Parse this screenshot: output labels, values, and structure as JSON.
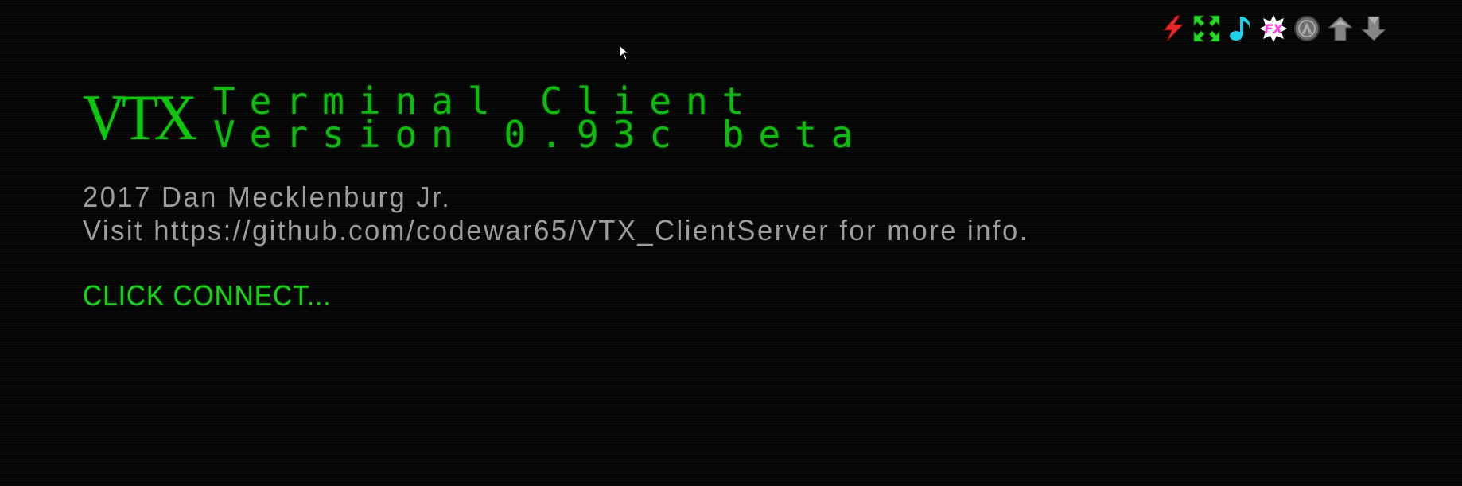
{
  "toolbar": {
    "items": [
      {
        "icon": "lightning-icon",
        "color": "#e8282c"
      },
      {
        "icon": "fullscreen-arrows-icon",
        "color": "#2ed82e"
      },
      {
        "icon": "music-note-icon",
        "color": "#1fd0e6"
      },
      {
        "icon": "fx-icon",
        "label": "FX",
        "color": "#ff3de0"
      },
      {
        "icon": "circle-a-icon",
        "color": "#8a8a8a"
      },
      {
        "icon": "upload-arrow-icon",
        "color": "#8a8a8a"
      },
      {
        "icon": "download-arrow-icon",
        "color": "#8a8a8a"
      }
    ]
  },
  "header": {
    "logo": "VTX",
    "title_line1": "Terminal Client",
    "title_line2": "Version 0.93c beta"
  },
  "info": {
    "line1": "2017 Dan Mecklenburg Jr.",
    "line2": "Visit https://github.com/codewar65/VTX_ClientServer for more info."
  },
  "status": {
    "text": "CLICK CONNECT..."
  },
  "colors": {
    "background": "#050505",
    "green": "#14b814",
    "gray_text": "#9d9d9d"
  }
}
